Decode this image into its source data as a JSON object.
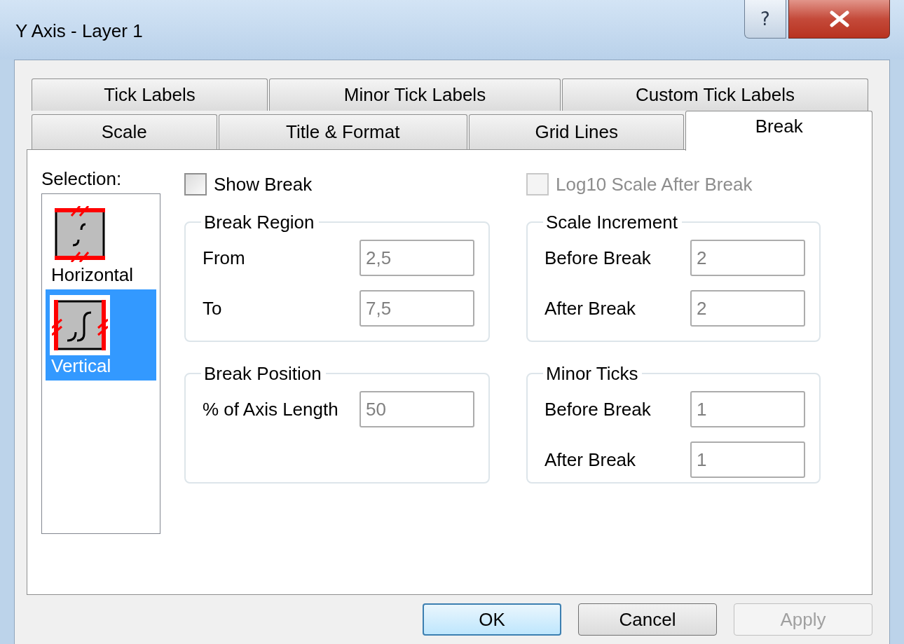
{
  "window": {
    "title": "Y Axis - Layer 1",
    "help_button": "?"
  },
  "tab_rows": [
    {
      "tabs": [
        {
          "label": "Tick Labels",
          "selected": false
        },
        {
          "label": "Minor Tick Labels",
          "selected": false
        },
        {
          "label": "Custom Tick Labels",
          "selected": false
        }
      ]
    },
    {
      "tabs": [
        {
          "label": "Scale",
          "selected": false
        },
        {
          "label": "Title & Format",
          "selected": false
        },
        {
          "label": "Grid Lines",
          "selected": false
        },
        {
          "label": "Break",
          "selected": true
        }
      ]
    }
  ],
  "selection": {
    "label": "Selection:",
    "items": [
      {
        "kind": "horizontal",
        "label": "Horizontal",
        "selected": false
      },
      {
        "kind": "vertical",
        "label": "Vertical",
        "selected": true
      }
    ]
  },
  "left_column": {
    "checkbox": {
      "label": "Show Break",
      "checked": false,
      "disabled": false
    },
    "groups": [
      {
        "title": "Break Region",
        "fields": [
          {
            "label": "From",
            "value": "2,5",
            "disabled": true
          },
          {
            "label": "To",
            "value": "7,5",
            "disabled": true
          }
        ]
      },
      {
        "title": "Break Position",
        "fields": [
          {
            "label": "% of Axis Length",
            "value": "50",
            "disabled": true
          }
        ]
      }
    ]
  },
  "right_column": {
    "checkbox": {
      "label": "Log10 Scale After Break",
      "checked": false,
      "disabled": true
    },
    "groups": [
      {
        "title": "Scale Increment",
        "fields": [
          {
            "label": "Before Break",
            "value": "2",
            "disabled": true
          },
          {
            "label": "After Break",
            "value": "2",
            "disabled": true
          }
        ]
      },
      {
        "title": "Minor Ticks",
        "fields": [
          {
            "label": "Before Break",
            "value": "1",
            "disabled": true
          },
          {
            "label": "After Break",
            "value": "1",
            "disabled": true
          }
        ]
      }
    ]
  },
  "buttons": [
    {
      "label": "OK",
      "default": true,
      "disabled": false
    },
    {
      "label": "Cancel",
      "default": false,
      "disabled": false
    },
    {
      "label": "Apply",
      "default": false,
      "disabled": true
    }
  ]
}
